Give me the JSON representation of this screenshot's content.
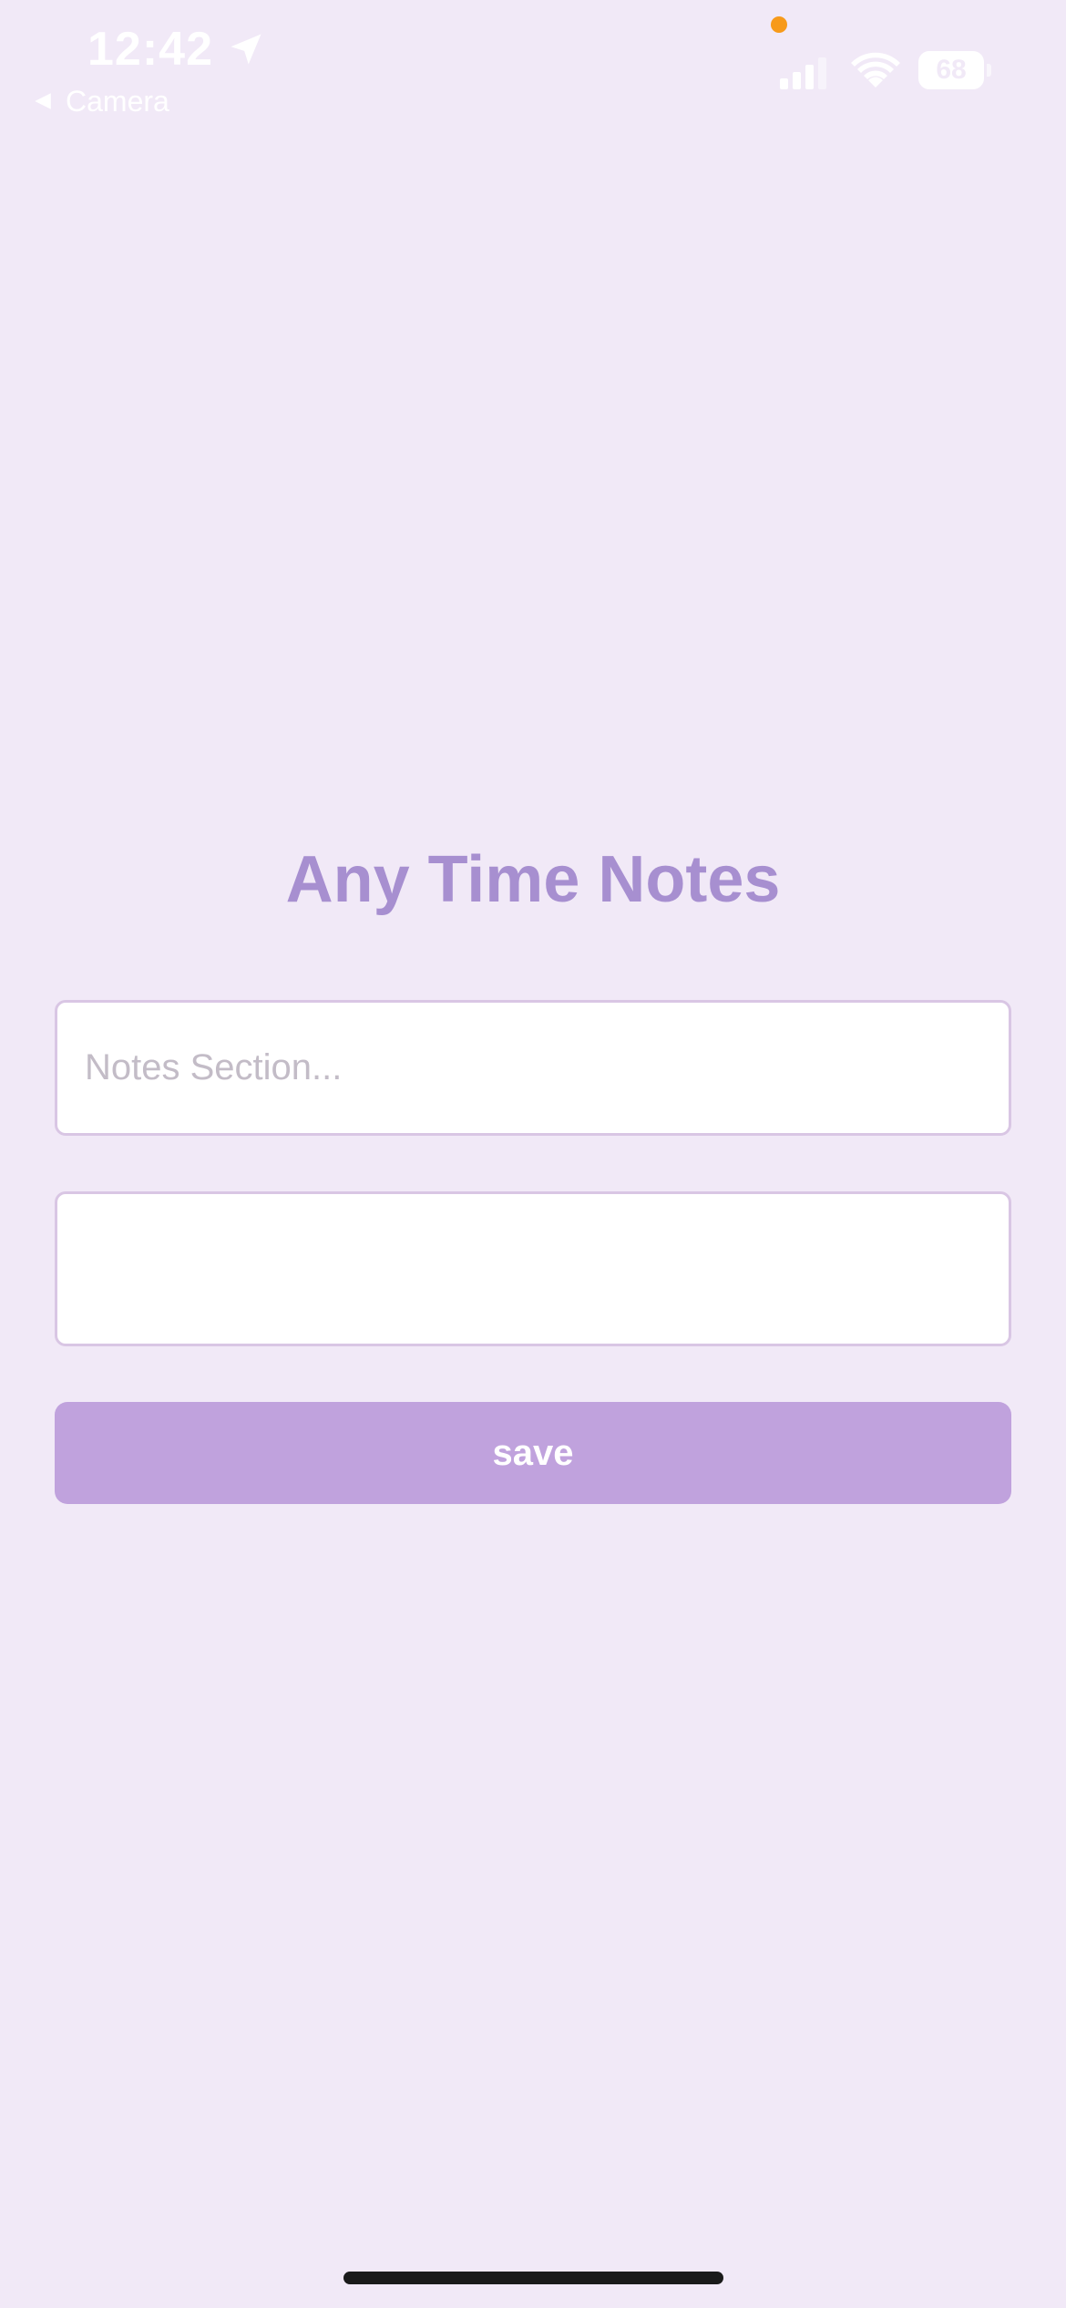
{
  "status_bar": {
    "time": "12:42",
    "back_label": "Camera",
    "battery_level": "68",
    "icons": [
      "location-arrow-icon",
      "back-arrow-icon",
      "cellular-signal-icon",
      "wifi-icon",
      "battery-icon"
    ]
  },
  "main": {
    "title": "Any Time Notes",
    "notes_input": {
      "placeholder": "Notes Section...",
      "value": ""
    },
    "second_input": {
      "placeholder": "",
      "value": ""
    },
    "save_label": "save"
  },
  "colors": {
    "background": "#f1e9f7",
    "title": "#a78fd0",
    "button": "#c0a2dd",
    "input_border": "#d9c6e4",
    "privacy_dot": "#f79a1a"
  }
}
